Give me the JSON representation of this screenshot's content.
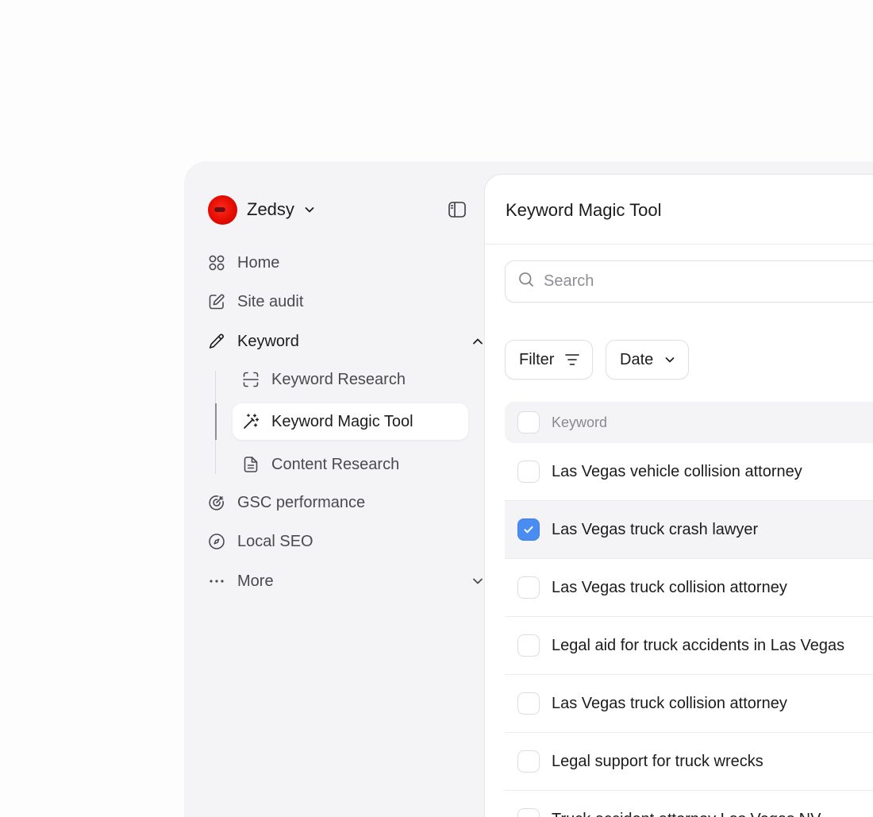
{
  "workspace": {
    "name": "Zedsy"
  },
  "sidebar": {
    "items": [
      {
        "label": "Home",
        "icon": "grid-icon"
      },
      {
        "label": "Site audit",
        "icon": "edit-square-icon"
      },
      {
        "label": "Keyword",
        "icon": "pencil-icon",
        "expanded": true
      },
      {
        "label": "GSC performance",
        "icon": "target-icon"
      },
      {
        "label": "Local SEO",
        "icon": "compass-icon"
      },
      {
        "label": "More",
        "icon": "more-dots-icon"
      }
    ],
    "keyword_subitems": [
      {
        "label": "Keyword Research",
        "icon": "scan-icon"
      },
      {
        "label": "Keyword Magic Tool",
        "icon": "magic-wand-icon",
        "active": true
      },
      {
        "label": "Content Research",
        "icon": "document-icon"
      }
    ]
  },
  "main": {
    "title": "Keyword Magic Tool",
    "search": {
      "placeholder": "Search"
    },
    "filters": {
      "filter_label": "Filter",
      "date_label": "Date"
    },
    "table": {
      "header": "Keyword",
      "rows": [
        {
          "keyword": "Las Vegas vehicle collision attorney",
          "checked": false
        },
        {
          "keyword": "Las Vegas truck crash lawyer",
          "checked": true
        },
        {
          "keyword": "Las Vegas truck collision attorney",
          "checked": false
        },
        {
          "keyword": "Legal aid for truck accidents in Las Vegas",
          "checked": false
        },
        {
          "keyword": "Las Vegas truck collision attorney",
          "checked": false
        },
        {
          "keyword": "Legal support for truck wrecks",
          "checked": false
        },
        {
          "keyword": "Truck accident attorney Las Vegas NV",
          "checked": false
        }
      ]
    }
  },
  "colors": {
    "accent": "#4a8df2",
    "brand": "#e30b00",
    "sidebar_bg": "#f4f3f5"
  }
}
